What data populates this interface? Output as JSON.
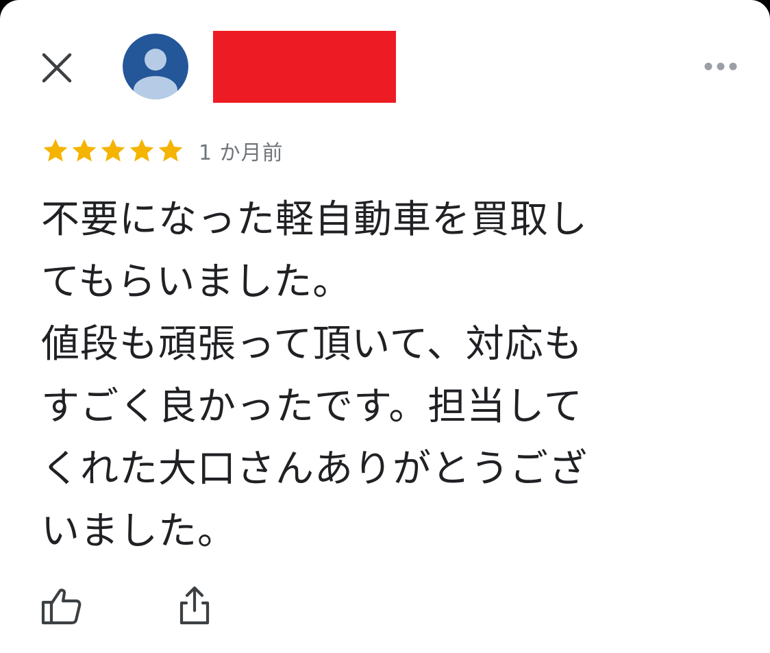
{
  "header": {
    "close_icon": "close-icon",
    "avatar_icon": "default-user-avatar",
    "reviewer_name": "",
    "more_icon": "more-horizontal-icon"
  },
  "rating": {
    "stars": 5,
    "max_stars": 5,
    "star_color": "#F4B400",
    "time_ago": "1 か月前"
  },
  "review": {
    "text": "不要になった軽自動車を買取し\nてもらいました。\n値段も頑張って頂いて、対応も\nすごく良かったです。担当して\nくれた大口さんありがとうござ\nいました。"
  },
  "actions": {
    "like_icon": "thumbs-up-icon",
    "share_icon": "share-icon"
  },
  "colors": {
    "avatar_bg": "#24569A",
    "avatar_fg": "#B6CCE6",
    "redaction": "#ED1C24",
    "secondary_text": "#70757A",
    "icon": "#3C4043"
  }
}
